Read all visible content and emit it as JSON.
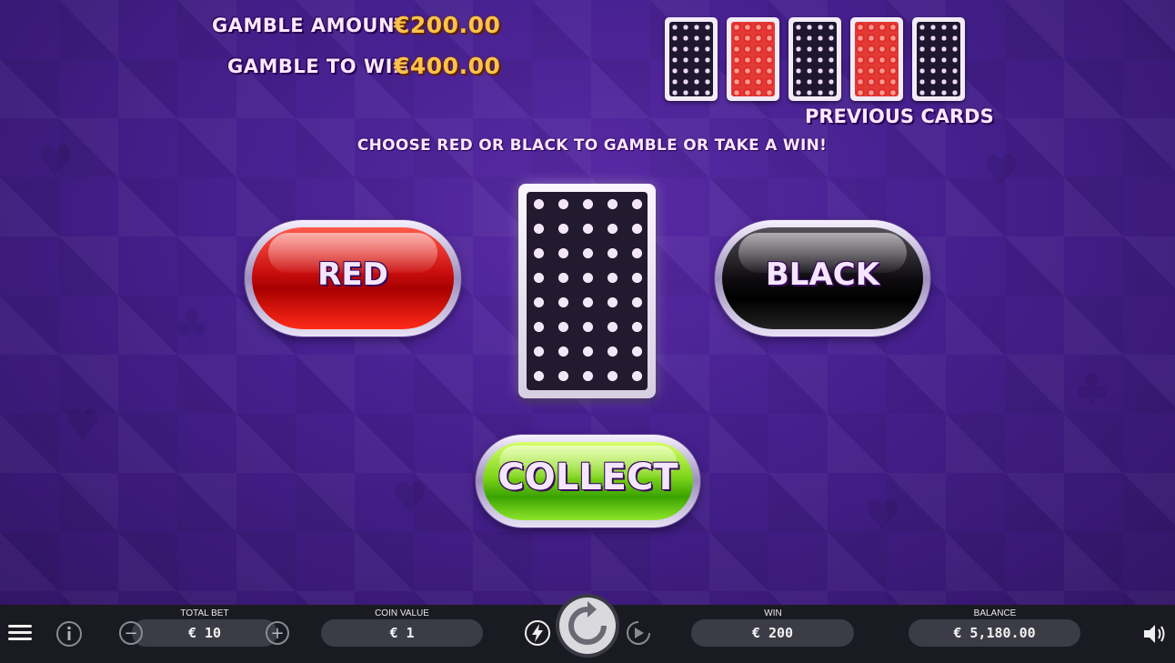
{
  "header": {
    "gamble_amount_label": "GAMBLE AMOUNT",
    "gamble_amount_value": "€200.00",
    "gamble_to_win_label": "GAMBLE TO WIN",
    "gamble_to_win_value": "€400.00"
  },
  "previous_cards": {
    "label": "PREVIOUS CARDS",
    "cards": [
      "black",
      "red",
      "black",
      "red",
      "black"
    ]
  },
  "instruction": "CHOOSE RED OR BLACK TO GAMBLE OR TAKE A WIN!",
  "buttons": {
    "red": "RED",
    "black": "BLACK",
    "collect": "COLLECT"
  },
  "bottom_bar": {
    "total_bet_label": "TOTAL BET",
    "total_bet_value": "€ 10",
    "coin_value_label": "COIN VALUE",
    "coin_value_value": "€ 1",
    "win_label": "WIN",
    "win_value": "€ 200",
    "balance_label": "BALANCE",
    "balance_value": "€ 5,180.00"
  },
  "colors": {
    "background": "#45208e",
    "amount": "#ffc24a",
    "red_button": "#c80d0d",
    "black_button": "#0e0c10",
    "collect_button": "#7ed41a",
    "bar": "#1a1a22"
  },
  "icons": [
    "menu-icon",
    "info-icon",
    "minus-icon",
    "plus-icon",
    "turbo-icon",
    "spin-icon",
    "autoplay-icon",
    "sound-icon"
  ]
}
